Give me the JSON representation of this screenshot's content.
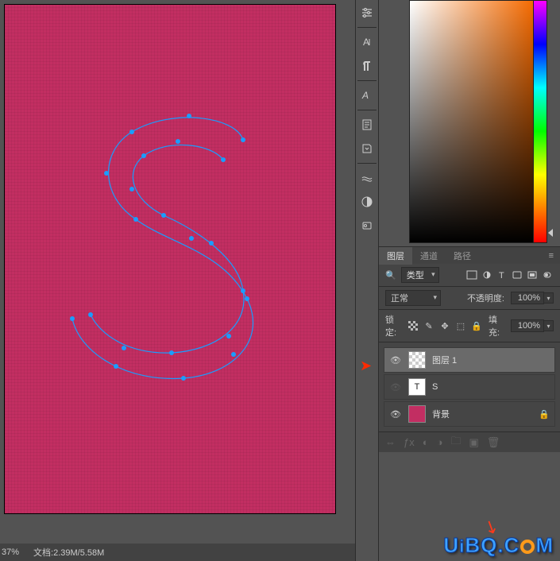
{
  "statusbar": {
    "zoom": "37%",
    "docinfo": "文档:2.39M/5.58M"
  },
  "tool_icons": [
    "sliders",
    "text-align",
    "paragraph",
    "glyphs",
    "notes",
    "script",
    "warp",
    "adjust",
    "badge"
  ],
  "panel_tabs": {
    "active": "图层",
    "tabs": [
      "图层",
      "通道",
      "路径"
    ]
  },
  "layer_filter": {
    "label": "类型"
  },
  "blend": {
    "mode": "正常",
    "opacity_label": "不透明度:",
    "opacity": "100%"
  },
  "lock": {
    "label": "锁定:",
    "fill_label": "填充:",
    "fill": "100%"
  },
  "layers": [
    {
      "visible": true,
      "thumb": "checker",
      "name": "图层 1",
      "selected": true
    },
    {
      "visible": false,
      "thumb": "T",
      "name": "S"
    },
    {
      "visible": true,
      "thumb": "bg",
      "name": "背景",
      "locked": true
    }
  ],
  "watermark": "UiBQ.CoM"
}
